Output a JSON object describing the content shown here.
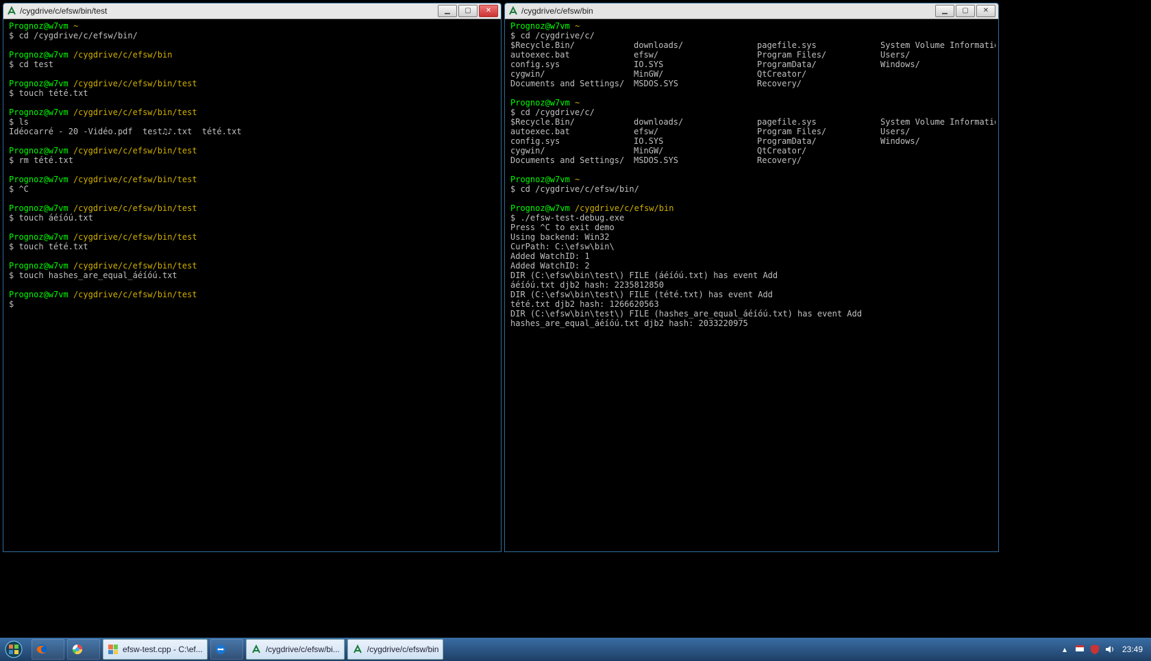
{
  "left_window": {
    "title": "/cygdrive/c/efsw/bin/test",
    "user_host": "Prognoz@w7vm",
    "blocks": [
      {
        "path": "~",
        "cmd": "cd /cygdrive/c/efsw/bin/"
      },
      {
        "path": "/cygdrive/c/efsw/bin",
        "cmd": "cd test"
      },
      {
        "path": "/cygdrive/c/efsw/bin/test",
        "cmd": "touch tété.txt"
      },
      {
        "path": "/cygdrive/c/efsw/bin/test",
        "cmd": "ls",
        "out": "Idéocarré - 20 -Vidéo.pdf  test♫♪.txt  tété.txt"
      },
      {
        "path": "/cygdrive/c/efsw/bin/test",
        "cmd": "rm tété.txt"
      },
      {
        "path": "/cygdrive/c/efsw/bin/test",
        "cmd": "^C"
      },
      {
        "path": "/cygdrive/c/efsw/bin/test",
        "cmd": "touch áéíóú.txt"
      },
      {
        "path": "/cygdrive/c/efsw/bin/test",
        "cmd": "touch tété.txt"
      },
      {
        "path": "/cygdrive/c/efsw/bin/test",
        "cmd": "touch hashes_are_equal_áéíóú.txt"
      },
      {
        "path": "/cygdrive/c/efsw/bin/test",
        "cmd": ""
      }
    ]
  },
  "right_window": {
    "title": "/cygdrive/c/efsw/bin",
    "user_host": "Prognoz@w7vm",
    "dir_rows": [
      [
        "$Recycle.Bin/",
        "downloads/",
        "pagefile.sys",
        "System Volume Information/"
      ],
      [
        "autoexec.bat",
        "efsw/",
        "Program Files/",
        "Users/"
      ],
      [
        "config.sys",
        "IO.SYS",
        "ProgramData/",
        "Windows/"
      ],
      [
        "cygwin/",
        "MinGW/",
        "QtCreator/",
        ""
      ],
      [
        "Documents and Settings/",
        "MSDOS.SYS",
        "Recovery/",
        ""
      ]
    ],
    "blocks": [
      {
        "type": "hdr",
        "path": "~",
        "cmd": "cd /cygdrive/c/"
      },
      {
        "type": "dir"
      },
      {
        "type": "hdr",
        "path": "~",
        "cmd": "cd /cygdrive/c/"
      },
      {
        "type": "dir"
      },
      {
        "type": "hdr",
        "path": "~",
        "cmd": "cd /cygdrive/c/efsw/bin/"
      },
      {
        "type": "hdr",
        "path": "/cygdrive/c/efsw/bin",
        "cmd": "./efsw-test-debug.exe"
      },
      {
        "type": "out",
        "lines": [
          "Press ^C to exit demo",
          "Using backend: Win32",
          "CurPath: C:\\efsw\\bin\\",
          "Added WatchID: 1",
          "Added WatchID: 2",
          "DIR (C:\\efsw\\bin\\test\\) FILE (áéíóú.txt) has event Add",
          "áéíóú.txt djb2 hash: 2235812850",
          "DIR (C:\\efsw\\bin\\test\\) FILE (tété.txt) has event Add",
          "tété.txt djb2 hash: 1266620563",
          "DIR (C:\\efsw\\bin\\test\\) FILE (hashes_are_equal_áéíóú.txt) has event Add",
          "hashes_are_equal_áéíóú.txt djb2 hash: 2033220975"
        ]
      }
    ]
  },
  "taskbar": {
    "buttons": [
      {
        "icon": "firefox-icon",
        "label": ""
      },
      {
        "icon": "chrome-icon",
        "label": ""
      },
      {
        "icon": "codeblocks-icon",
        "label": "efsw-test.cpp - C:\\ef...",
        "labeled": true
      },
      {
        "icon": "teamviewer-icon",
        "label": ""
      },
      {
        "icon": "cygwin-icon",
        "label": "/cygdrive/c/efsw/bi...",
        "labeled": true
      },
      {
        "icon": "cygwin-icon",
        "label": "/cygdrive/c/efsw/bin",
        "labeled": true
      }
    ],
    "tray_chevron": "▴",
    "tray_icons": [
      "flag-icon",
      "shield-icon",
      "speaker-icon"
    ],
    "clock": "23:49"
  }
}
